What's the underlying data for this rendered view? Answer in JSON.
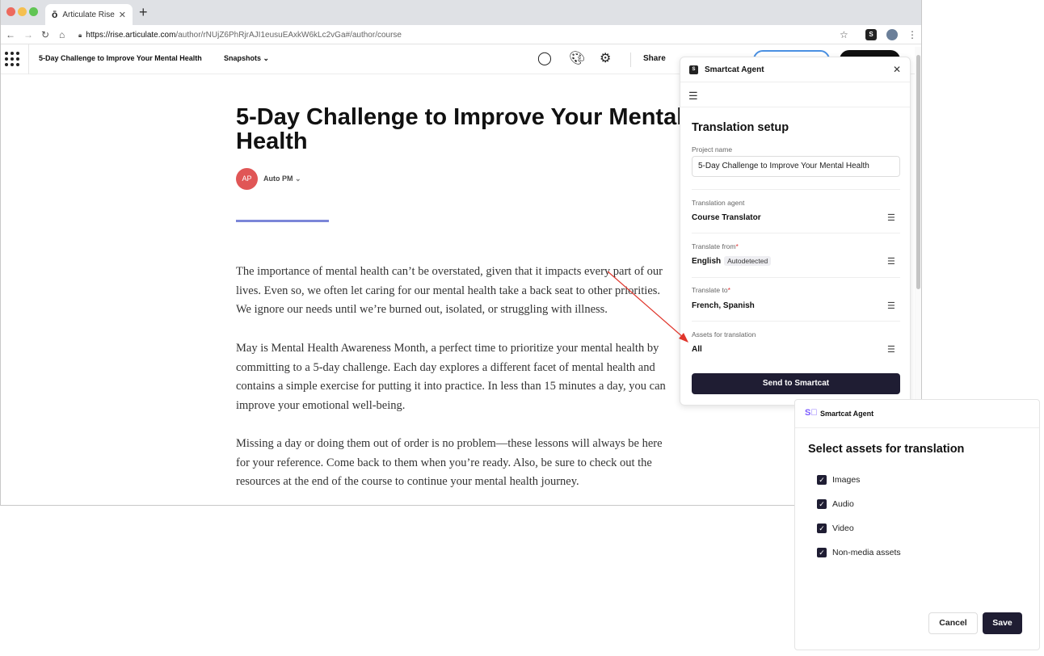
{
  "browser": {
    "tab_title": "Articulate Rise",
    "tab_favicon": "ō",
    "url_host": "https://rise.articulate.com",
    "url_path": "/author/rNUjZ6PhRjrAJI1eusuEAxkW6kLc2vGa#/author/course",
    "traffic_colors": [
      "#ed6a5e",
      "#f5bf4f",
      "#61c554"
    ]
  },
  "app": {
    "course_title": "5-Day Challenge to Improve Your Mental Health",
    "snapshots_label": "Snapshots",
    "share_label": "Share"
  },
  "course": {
    "heading": "5-Day Challenge to Improve Your Mental Health",
    "author_initials": "AP",
    "author_name": "Auto PM",
    "paragraphs": [
      "The importance of mental health can’t be overstated, given that it impacts every part of our lives. Even so, we often let caring for our mental health take a back seat to other priorities. We ignore our needs until we’re burned out, isolated, or struggling with illness.",
      "May is Mental Health Awareness Month, a perfect time to prioritize your mental health by committing to a 5-day challenge. Each day explores a different facet of mental health and contains a simple exercise for putting it into practice. In less than 15 minutes a day, you can improve your emotional well-being.",
      "Missing a day or doing them out of order is no problem—these lessons will always be here for your reference. Come back to them when you’re ready. Also, be sure to check out the resources at the end of the course to continue your mental health journey."
    ]
  },
  "agent_panel": {
    "title": "Smartcat Agent",
    "heading": "Translation setup",
    "project_name_label": "Project name",
    "project_name_value": "5-Day Challenge to Improve Your Mental Health",
    "agent_label": "Translation agent",
    "agent_value": "Course Translator",
    "from_label": "Translate from",
    "from_value": "English",
    "from_badge": "Autodetected",
    "to_label": "Translate to",
    "to_value": "French, Spanish",
    "assets_label": "Assets for translation",
    "assets_value": "All",
    "send_button": "Send to Smartcat"
  },
  "assets_panel": {
    "title": "Smartcat Agent",
    "heading": "Select assets for translation",
    "options": [
      {
        "label": "Images",
        "checked": true
      },
      {
        "label": "Audio",
        "checked": true
      },
      {
        "label": "Video",
        "checked": true
      },
      {
        "label": "Non-media assets",
        "checked": true
      }
    ],
    "cancel_button": "Cancel",
    "save_button": "Save"
  },
  "colors": {
    "accent_dark": "#1f1d33",
    "annotation_arrow": "#e0352b",
    "divider": "#7b86d8"
  }
}
